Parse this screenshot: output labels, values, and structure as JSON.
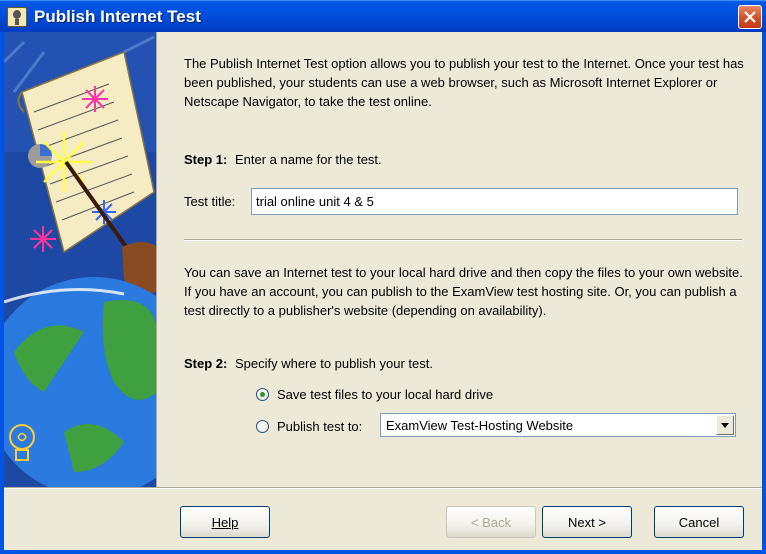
{
  "window": {
    "title": "Publish Internet Test"
  },
  "intro": {
    "text": "The Publish Internet Test option allows you to publish your test to the Internet. Once your test has been published, your students can use a web browser, such as Microsoft Internet Explorer or Netscape Navigator, to take the test online."
  },
  "step1": {
    "label": "Step 1:",
    "text": "Enter a name for the test."
  },
  "test_title": {
    "label": "Test title:",
    "value": "trial online unit 4 & 5"
  },
  "description2": {
    "text": "You can save an Internet test to your local hard drive and then copy the files to your own website.  If you have an account, you can publish to the ExamView test hosting site.  Or, you can publish a test directly to a publisher's website (depending on availability)."
  },
  "step2": {
    "label": "Step 2:",
    "text": "Specify where to publish your test."
  },
  "options": {
    "save_local": "Save test files to your local hard drive",
    "publish_to": "Publish test to:",
    "selected": "save_local"
  },
  "publish_select": {
    "value": "ExamView Test-Hosting Website"
  },
  "buttons": {
    "help": "Help",
    "back": "< Back",
    "next": "Next >",
    "cancel": "Cancel"
  }
}
